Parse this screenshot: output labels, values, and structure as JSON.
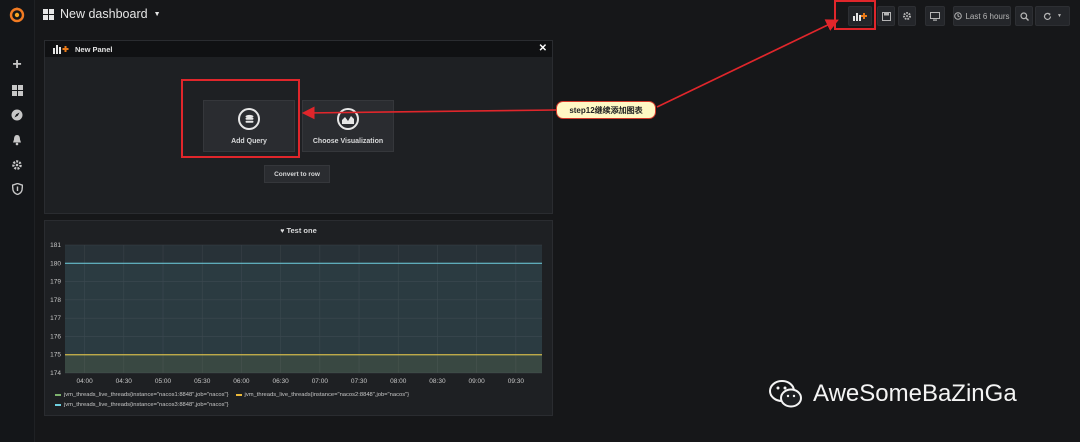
{
  "header": {
    "dashboard_title": "New dashboard",
    "time_range": "Last 6 hours"
  },
  "new_panel": {
    "title": "New Panel",
    "add_query_label": "Add Query",
    "choose_visualization_label": "Choose Visualization",
    "convert_to_row_label": "Convert to row"
  },
  "annotation": {
    "callout_text": "step12继续添加图表"
  },
  "chart_panel": {
    "title": "Test one"
  },
  "chart_data": {
    "type": "line",
    "title": "Test one",
    "x": [
      "04:00",
      "04:30",
      "05:00",
      "05:30",
      "06:00",
      "06:30",
      "07:00",
      "07:30",
      "08:00",
      "08:30",
      "09:00",
      "09:30"
    ],
    "yticks": [
      174,
      175,
      176,
      177,
      178,
      179,
      180,
      181
    ],
    "ylim": [
      174,
      181
    ],
    "xlim": [
      "03:45",
      "09:50"
    ],
    "grid": true,
    "legend_position": "bottom",
    "series": [
      {
        "name": "jvm_threads_live_threads{instance=\"nacos1:8848\",job=\"nacos\"}",
        "color": "#7eb26d",
        "values": [
          175,
          175,
          175,
          175,
          175,
          175,
          175,
          175,
          175,
          175,
          175,
          175
        ]
      },
      {
        "name": "jvm_threads_live_threads{instance=\"nacos2:8848\",job=\"nacos\"}",
        "color": "#eab839",
        "values": [
          175,
          175,
          175,
          175,
          175,
          175,
          175,
          175,
          175,
          175,
          175,
          175
        ]
      },
      {
        "name": "jvm_threads_live_threads{instance=\"nacos3:8848\",job=\"nacos\"}",
        "color": "#6ed0e0",
        "values": [
          180,
          180,
          180,
          180,
          180,
          180,
          180,
          180,
          180,
          180,
          180,
          180
        ]
      }
    ]
  },
  "watermark": {
    "text": "AweSomeBaZinGa"
  },
  "colors": {
    "accent": "#e0262b",
    "callout_bg": "#fff8c4"
  }
}
